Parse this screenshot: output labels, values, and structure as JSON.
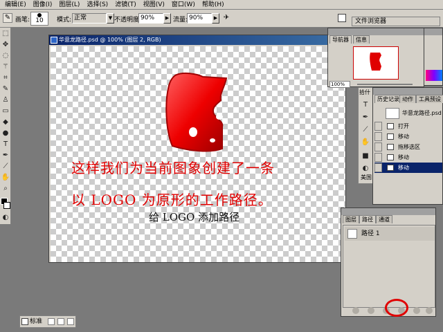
{
  "menu": [
    "编辑(E)",
    "图像(I)",
    "图层(L)",
    "选择(S)",
    "滤镜(T)",
    "视图(V)",
    "窗口(W)",
    "帮助(H)"
  ],
  "options": {
    "brush_label": "画笔:",
    "brush_size": "10",
    "mode_label": "模式:",
    "mode_value": "正常",
    "opacity_label": "不透明度:",
    "opacity_value": "90%",
    "flow_label": "流量:",
    "flow_value": "90%",
    "file_browser_tab": "文件浏览器"
  },
  "document": {
    "title": "华意龙路径.psd @ 100% (图层 2, RGB)",
    "annotation_line1": "这样我们为当前图象创建了一条",
    "annotation_line2": "以 LOGO 为原形的工作路径。",
    "caption": "给 LOGO 添加路径"
  },
  "navigator": {
    "tabs": [
      "导航器",
      "信息"
    ],
    "zoom": "100%"
  },
  "history": {
    "tabs": [
      "历史记录",
      "动作",
      "工具预设"
    ],
    "snapshot": "华意龙路径.psd",
    "items": [
      "打开",
      "移动",
      "拖移选区",
      "移动",
      "移动"
    ],
    "selected_index": 4,
    "panel_label": "拾什",
    "bottom_label": "美国"
  },
  "paths": {
    "tabs": [
      "图层",
      "路径",
      "通道"
    ],
    "items": [
      "路径 1"
    ]
  },
  "status": {
    "standard_label": "标准"
  },
  "colors": {
    "accent_red": "#e00000",
    "title_blue": "#0a246a",
    "panel_gray": "#d4d0c8"
  }
}
